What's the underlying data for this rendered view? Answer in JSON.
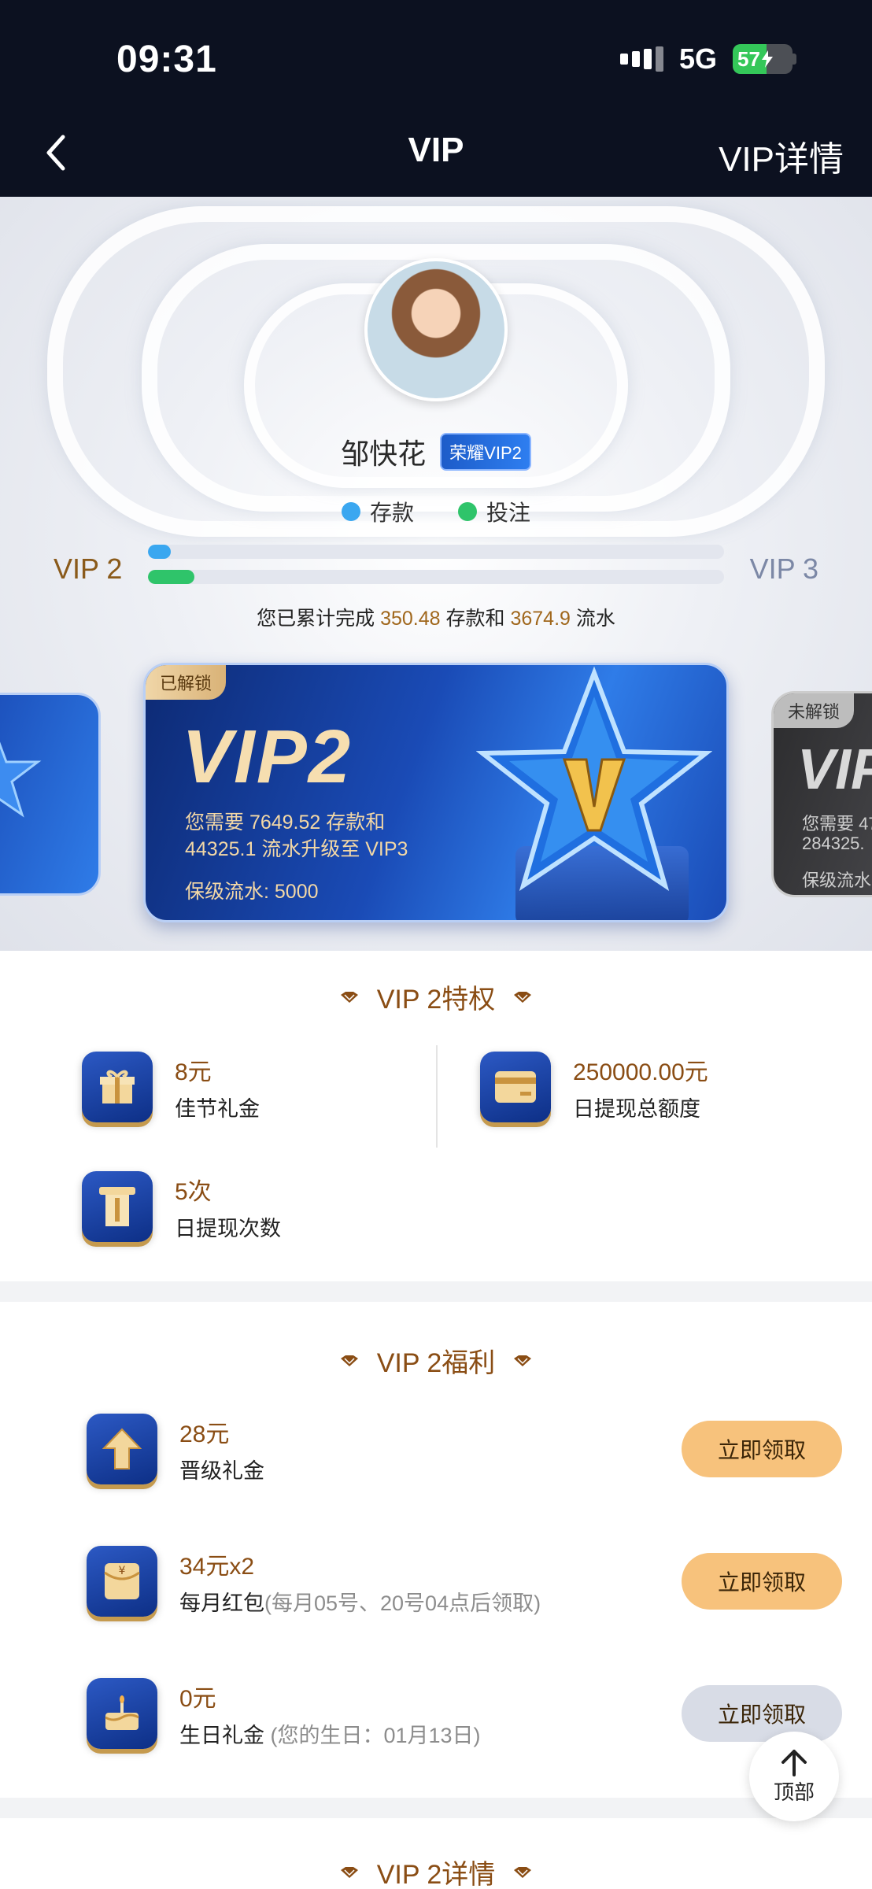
{
  "status_bar": {
    "time": "09:31",
    "network": "5G",
    "battery": "57",
    "battery_percent": 57
  },
  "nav": {
    "title": "VIP",
    "right_label": "VIP详情"
  },
  "profile": {
    "name": "邹快花",
    "badge": "荣耀VIP2",
    "legend": [
      {
        "label": "存款",
        "color": "#3aa7f0"
      },
      {
        "label": "投注",
        "color": "#2fc46a"
      }
    ],
    "current_level": "VIP 2",
    "next_level": "VIP 3",
    "progress_deposit": 0.04,
    "progress_bet": 0.08,
    "summary_prefix": "您已累计完成",
    "summary_deposit": "350.48",
    "summary_mid": "存款和",
    "summary_bet": "3674.9",
    "summary_suffix": "流水"
  },
  "cards": {
    "main": {
      "tag": "已解锁",
      "title": "VIP2",
      "line1": "您需要 7649.52 存款和",
      "line2": "44325.1 流水升级至 VIP3",
      "keep": "保级流水:    5000"
    },
    "next": {
      "tag": "未解锁",
      "title": "VIP",
      "line1": "您需要 47",
      "line2": "284325.",
      "line3": "保级流水:"
    }
  },
  "privileges": {
    "title": "VIP 2特权",
    "items": [
      {
        "value": "8元",
        "label": "佳节礼金",
        "icon": "gift-icon"
      },
      {
        "value": "250000.00元",
        "label": "日提现总额度",
        "icon": "card-icon"
      },
      {
        "value": "5次",
        "label": "日提现次数",
        "icon": "withdraw-icon"
      }
    ]
  },
  "welfare": {
    "title": "VIP 2福利",
    "items": [
      {
        "value": "28元",
        "label": "晋级礼金",
        "note": "",
        "button": "立即领取",
        "icon": "upgrade-arrow-icon"
      },
      {
        "value": "34元x2",
        "label": "每月红包",
        "note": "(每月05号、20号04点后领取)",
        "button": "立即领取",
        "icon": "red-envelope-icon"
      },
      {
        "value": "0元",
        "label": "生日礼金",
        "note": "  (您的生日：01月13日)",
        "button": "立即领取",
        "icon": "birthday-cake-icon"
      }
    ]
  },
  "details": {
    "title": "VIP 2详情"
  },
  "fab": {
    "label": "顶部"
  },
  "colors": {
    "accent_gold": "#8a4d14",
    "claim_active": "#f7c27c",
    "claim_disabled": "#d8dce6",
    "nav_bg": "#0c1120"
  }
}
